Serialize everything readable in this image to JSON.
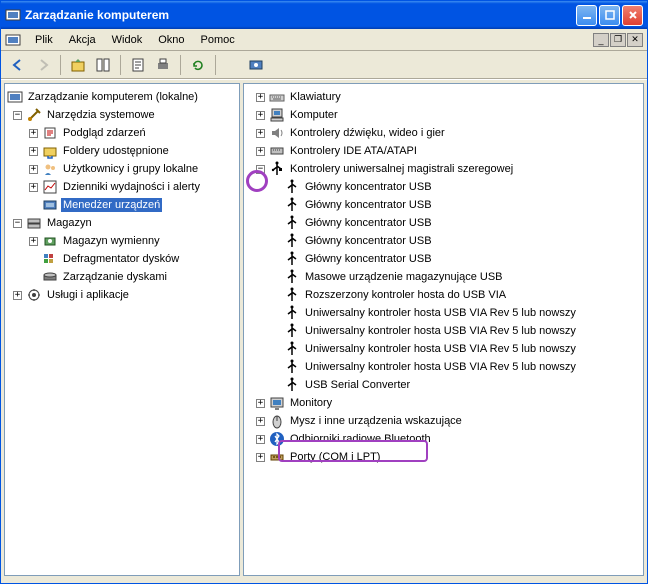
{
  "window": {
    "title": "Zarządzanie komputerem"
  },
  "menubar": {
    "items": [
      "Plik",
      "Akcja",
      "Widok",
      "Okno",
      "Pomoc"
    ]
  },
  "leftTree": {
    "root": "Zarządzanie komputerem (lokalne)",
    "n0": "Narzędzia systemowe",
    "n0_0": "Podgląd zdarzeń",
    "n0_1": "Foldery udostępnione",
    "n0_2": "Użytkownicy i grupy lokalne",
    "n0_3": "Dzienniki wydajności i alerty",
    "n0_4": "Menedżer urządzeń",
    "n1": "Magazyn",
    "n1_0": "Magazyn wymienny",
    "n1_1": "Defragmentator dysków",
    "n1_2": "Zarządzanie dyskami",
    "n2": "Usługi i aplikacje"
  },
  "rightTree": {
    "r0": "Klawiatury",
    "r1": "Komputer",
    "r2": "Kontrolery dźwięku, wideo i gier",
    "r3": "Kontrolery IDE ATA/ATAPI",
    "r4": "Kontrolery uniwersalnej magistrali szeregowej",
    "r4_0": "Główny koncentrator USB",
    "r4_1": "Główny koncentrator USB",
    "r4_2": "Główny koncentrator USB",
    "r4_3": "Główny koncentrator USB",
    "r4_4": "Główny koncentrator USB",
    "r4_5": "Masowe urządzenie magazynujące USB",
    "r4_6": "Rozszerzony kontroler hosta do USB VIA",
    "r4_7": "Uniwersalny kontroler hosta USB VIA Rev 5 lub nowszy",
    "r4_8": "Uniwersalny kontroler hosta USB VIA Rev 5 lub nowszy",
    "r4_9": "Uniwersalny kontroler hosta USB VIA Rev 5 lub nowszy",
    "r4_10": "Uniwersalny kontroler hosta USB VIA Rev 5 lub nowszy",
    "r4_11": "USB Serial Converter",
    "r5": "Monitory",
    "r6": "Mysz i inne urządzenia wskazujące",
    "r7": "Odbiorniki radiowe Bluetooth",
    "r8": "Porty (COM i LPT)"
  }
}
